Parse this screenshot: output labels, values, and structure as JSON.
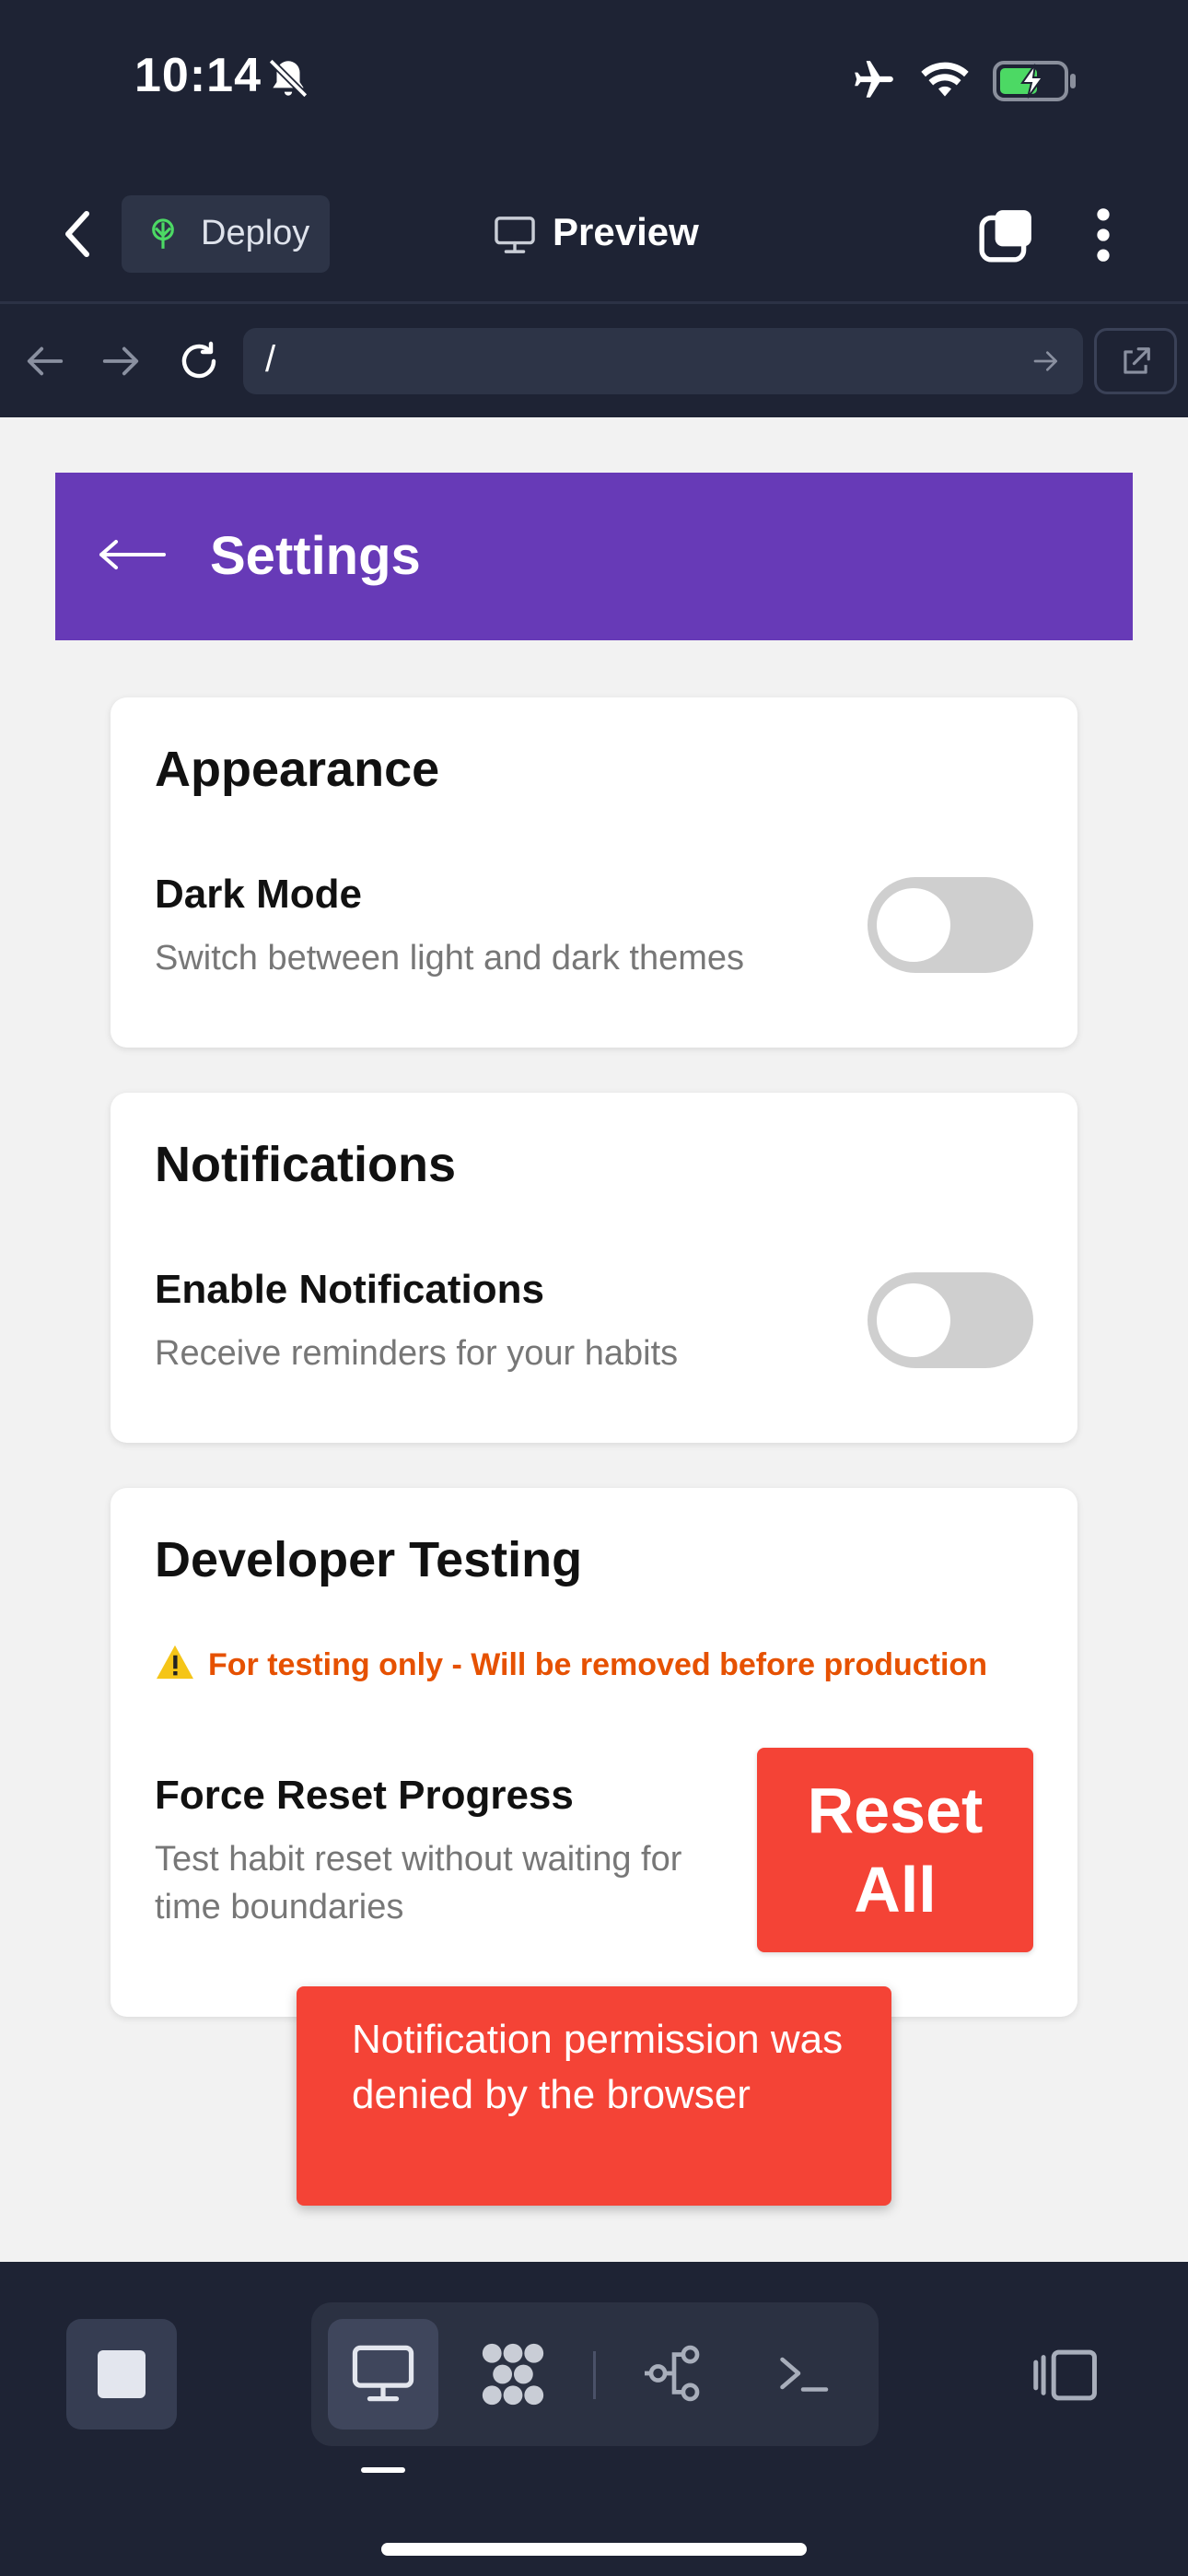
{
  "status_bar": {
    "time": "10:14",
    "icons": [
      "bell-off-icon",
      "airplane-icon",
      "wifi-icon",
      "battery-charging-icon"
    ]
  },
  "app_bar": {
    "deploy_label": "Deploy",
    "preview_label": "Preview",
    "icons": [
      "back-chevron-icon",
      "deploy-icon",
      "monitor-icon",
      "tabs-icon",
      "kebab-menu-icon"
    ]
  },
  "browser": {
    "url": "/",
    "icons": [
      "nav-back-icon",
      "nav-forward-icon",
      "reload-icon",
      "url-go-icon",
      "external-link-icon"
    ]
  },
  "settings": {
    "header_title": "Settings",
    "appearance": {
      "title": "Appearance",
      "dark_mode_label": "Dark Mode",
      "dark_mode_desc": "Switch between light and dark themes",
      "dark_mode_on": false
    },
    "notifications": {
      "title": "Notifications",
      "enable_label": "Enable Notifications",
      "enable_desc": "Receive reminders for your habits",
      "enabled": false
    },
    "developer": {
      "title": "Developer Testing",
      "warning": "For testing only - Will be removed before production",
      "force_reset_label": "Force Reset Progress",
      "force_reset_desc": "Test habit reset without waiting for time boundaries",
      "reset_button_label": "Reset All"
    }
  },
  "toast": {
    "message": "Notification permission was denied by the browser"
  },
  "colors": {
    "chrome_bg": "#1e2334",
    "header_purple": "#673ab7",
    "danger_red": "#f44336",
    "warning_orange": "#e65100",
    "toggle_off": "#cfcfcf"
  },
  "bottom_bar": {
    "icons": [
      "stop-icon",
      "monitor-icon",
      "apps-icon",
      "connect-icon",
      "terminal-icon",
      "panel-icon"
    ]
  }
}
